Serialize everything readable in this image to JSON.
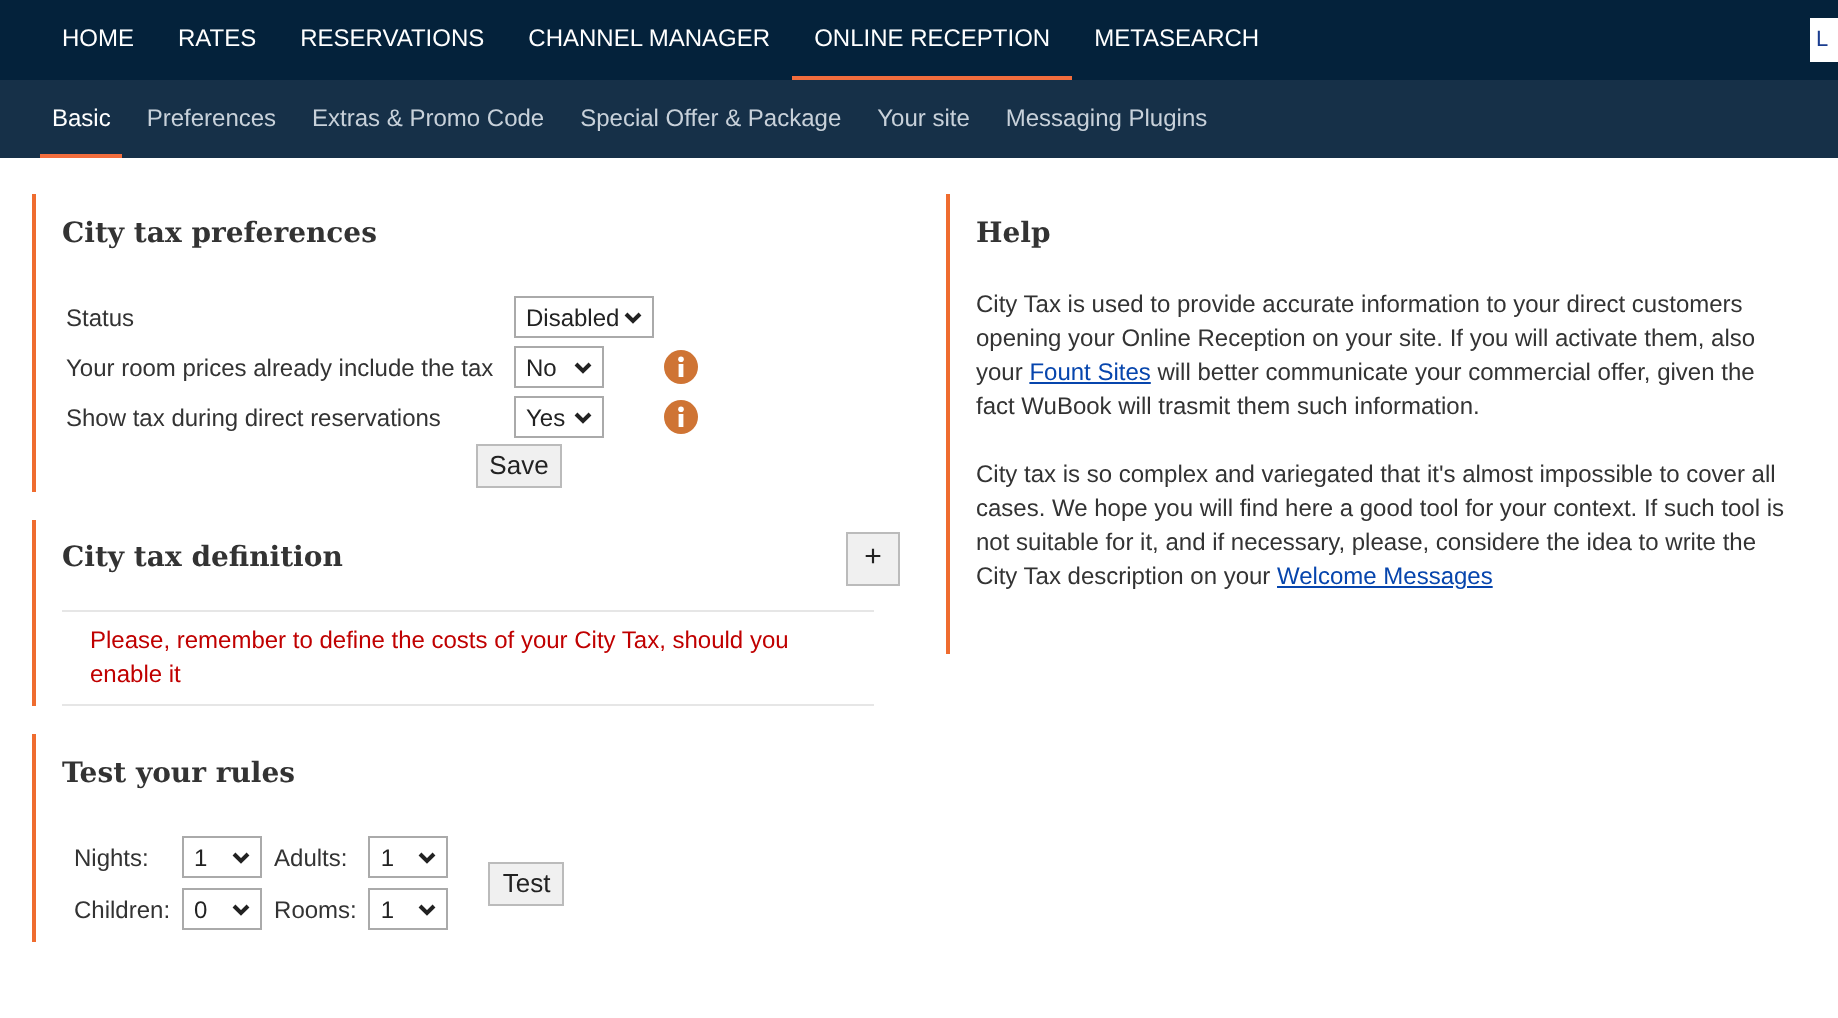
{
  "top_nav": {
    "items": [
      {
        "label": "HOME",
        "selected": false
      },
      {
        "label": "RATES",
        "selected": false
      },
      {
        "label": "RESERVATIONS",
        "selected": false
      },
      {
        "label": "CHANNEL MANAGER",
        "selected": false
      },
      {
        "label": "ONLINE RECEPTION",
        "selected": true
      },
      {
        "label": "METASEARCH",
        "selected": false
      }
    ],
    "corner_button": "L"
  },
  "sub_nav": {
    "items": [
      {
        "label": "Basic",
        "selected": true
      },
      {
        "label": "Preferences",
        "selected": false
      },
      {
        "label": "Extras & Promo Code",
        "selected": false
      },
      {
        "label": "Special Offer & Package",
        "selected": false
      },
      {
        "label": "Your site",
        "selected": false
      },
      {
        "label": "Messaging Plugins",
        "selected": false
      }
    ]
  },
  "preferences": {
    "title": "City tax preferences",
    "rows": [
      {
        "label": "Status",
        "value": "Disabled",
        "info": false
      },
      {
        "label": "Your room prices already include the tax",
        "value": "No",
        "info": true
      },
      {
        "label": "Show tax during direct reservations",
        "value": "Yes",
        "info": true
      }
    ],
    "save_button": "Save"
  },
  "definition": {
    "title": "City tax definition",
    "add_button": "+",
    "warning": "Please, remember to define the costs of your City Tax, should you enable it"
  },
  "test": {
    "title": "Test your rules",
    "fields": [
      {
        "label": "Nights:",
        "value": "1"
      },
      {
        "label": "Adults:",
        "value": "1"
      },
      {
        "label": "Children:",
        "value": "0"
      },
      {
        "label": "Rooms:",
        "value": "1"
      }
    ],
    "test_button": "Test"
  },
  "help": {
    "title": "Help",
    "paragraphs": [
      {
        "before": "City Tax is used to provide accurate information to your direct customers opening your Online Reception on your site. If you will activate them, also your ",
        "link": "Fount Sites",
        "after": " will better communicate your commercial offer, given the fact WuBook will trasmit them such information."
      },
      {
        "before": "City tax is so complex and variegated that it's almost impossible to cover all cases. We hope you will find here a good tool for your context. If such tool is not suitable for it, and if necessary, please, considere the idea to write the City Tax description on your ",
        "link": "Welcome Messages"
      }
    ]
  }
}
